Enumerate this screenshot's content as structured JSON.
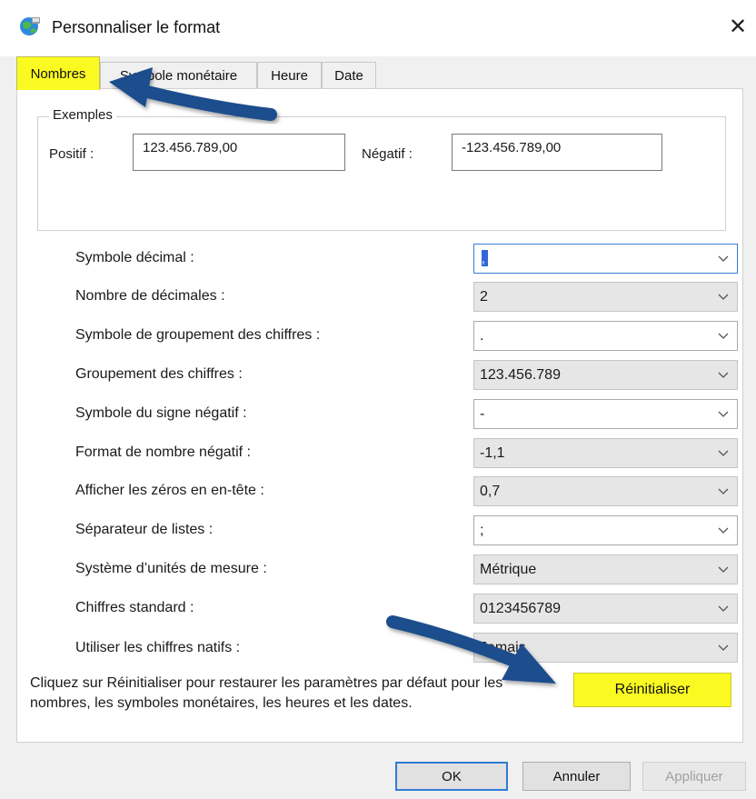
{
  "window": {
    "title": "Personnaliser le format",
    "close_glyph": "✕",
    "icon": "globe-network-icon"
  },
  "tabs": [
    {
      "label": "Nombres",
      "active": true
    },
    {
      "label": "Symbole monétaire",
      "active": false
    },
    {
      "label": "Heure",
      "active": false
    },
    {
      "label": "Date",
      "active": false
    }
  ],
  "examples": {
    "legend": "Exemples",
    "positive_label": "Positif :",
    "positive_value": "123.456.789,00",
    "negative_label": "Négatif :",
    "negative_value": "-123.456.789,00"
  },
  "settings": [
    {
      "label": "Symbole décimal :",
      "value": ",",
      "editable": true
    },
    {
      "label": "Nombre de décimales :",
      "value": "2",
      "editable": false
    },
    {
      "label": "Symbole de groupement des chiffres :",
      "value": ".",
      "editable": true
    },
    {
      "label": "Groupement des chiffres :",
      "value": "123.456.789",
      "editable": false
    },
    {
      "label": "Symbole du signe négatif :",
      "value": "-",
      "editable": true
    },
    {
      "label": "Format de nombre négatif :",
      "value": "-1,1",
      "editable": false
    },
    {
      "label": "Afficher les zéros en en-tête :",
      "value": "0,7",
      "editable": false
    },
    {
      "label": "Séparateur de listes :",
      "value": ";",
      "editable": true
    },
    {
      "label": "Système d’unités de mesure :",
      "value": "Métrique",
      "editable": false
    },
    {
      "label": "Chiffres standard :",
      "value": "0123456789",
      "editable": false
    },
    {
      "label": "Utiliser les chiffres natifs :",
      "value": "Jamais",
      "editable": false
    }
  ],
  "info_text": "Cliquez sur Réinitialiser pour restaurer les paramètres par défaut pour les nombres, les symboles monétaires, les heures et les dates.",
  "buttons": {
    "reset": "Réinitialiser",
    "ok": "OK",
    "cancel": "Annuler",
    "apply": "Appliquer"
  },
  "colors": {
    "highlight": "#fafa22",
    "annotation_arrow": "#1f4e8c",
    "focus_border": "#2f7bd6"
  }
}
